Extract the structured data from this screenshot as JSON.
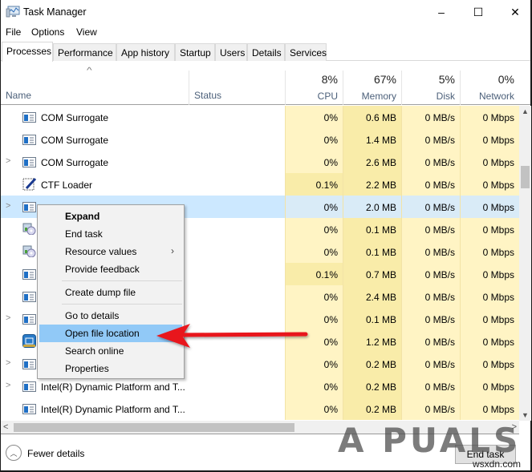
{
  "window": {
    "title": "Task Manager",
    "controls": {
      "minimize": "–",
      "maximize": "☐",
      "close": "✕"
    }
  },
  "menu": [
    "File",
    "Options",
    "View"
  ],
  "tabs": [
    {
      "label": "Processes",
      "active": true
    },
    {
      "label": "Performance",
      "active": false
    },
    {
      "label": "App history",
      "active": false
    },
    {
      "label": "Startup",
      "active": false
    },
    {
      "label": "Users",
      "active": false
    },
    {
      "label": "Details",
      "active": false
    },
    {
      "label": "Services",
      "active": false
    }
  ],
  "columns": {
    "name": "Name",
    "status": "Status",
    "cpu": {
      "percent": "8%",
      "label": "CPU"
    },
    "memory": {
      "percent": "67%",
      "label": "Memory"
    },
    "disk": {
      "percent": "5%",
      "label": "Disk"
    },
    "network": {
      "percent": "0%",
      "label": "Network"
    }
  },
  "rows": [
    {
      "name": "COM Surrogate",
      "icon": "app-window-icon",
      "expander": false,
      "cpu": "0%",
      "memory": "0.6 MB",
      "disk": "0 MB/s",
      "network": "0 Mbps"
    },
    {
      "name": "COM Surrogate",
      "icon": "app-window-icon",
      "expander": false,
      "cpu": "0%",
      "memory": "1.4 MB",
      "disk": "0 MB/s",
      "network": "0 Mbps"
    },
    {
      "name": "COM Surrogate",
      "icon": "app-window-icon",
      "expander": true,
      "cpu": "0%",
      "memory": "2.6 MB",
      "disk": "0 MB/s",
      "network": "0 Mbps"
    },
    {
      "name": "CTF Loader",
      "icon": "ctf-loader-icon",
      "expander": false,
      "cpu": "0.1%",
      "memory": "2.2 MB",
      "disk": "0 MB/s",
      "network": "0 Mbps"
    },
    {
      "name": "",
      "icon": "app-window-icon",
      "expander": true,
      "selected": true,
      "cpu": "0%",
      "memory": "2.0 MB",
      "disk": "0 MB/s",
      "network": "0 Mbps"
    },
    {
      "name": "",
      "icon": "installer-disc-icon",
      "expander": false,
      "cpu": "0%",
      "memory": "0.1 MB",
      "disk": "0 MB/s",
      "network": "0 Mbps"
    },
    {
      "name": "",
      "icon": "installer-disc-icon",
      "expander": false,
      "cpu": "0%",
      "memory": "0.1 MB",
      "disk": "0 MB/s",
      "network": "0 Mbps"
    },
    {
      "name": "",
      "icon": "app-window-icon",
      "expander": false,
      "cpu": "0.1%",
      "memory": "0.7 MB",
      "disk": "0 MB/s",
      "network": "0 Mbps"
    },
    {
      "name": "",
      "icon": "app-window-icon",
      "expander": false,
      "cpu": "0%",
      "memory": "2.4 MB",
      "disk": "0 MB/s",
      "network": "0 Mbps"
    },
    {
      "name": "",
      "icon": "app-window-icon",
      "expander": true,
      "cpu": "0%",
      "memory": "0.1 MB",
      "disk": "0 MB/s",
      "network": "0 Mbps"
    },
    {
      "name": "",
      "icon": "intel-graphics-icon",
      "expander": false,
      "cpu": "0%",
      "memory": "1.2 MB",
      "disk": "0 MB/s",
      "network": "0 Mbps"
    },
    {
      "name": "",
      "icon": "app-window-icon",
      "expander": true,
      "cpu": "0%",
      "memory": "0.2 MB",
      "disk": "0 MB/s",
      "network": "0 Mbps"
    },
    {
      "name": "Intel(R) Dynamic Platform and T...",
      "icon": "app-window-icon",
      "expander": true,
      "cpu": "0%",
      "memory": "0.2 MB",
      "disk": "0 MB/s",
      "network": "0 Mbps"
    },
    {
      "name": "Intel(R) Dynamic Platform and T...",
      "icon": "app-window-icon",
      "expander": false,
      "cpu": "0%",
      "memory": "0.2 MB",
      "disk": "0 MB/s",
      "network": "0 Mbps"
    }
  ],
  "context_menu": {
    "groups": [
      [
        {
          "label": "Expand",
          "bold": true
        },
        {
          "label": "End task"
        },
        {
          "label": "Resource values",
          "submenu": true
        },
        {
          "label": "Provide feedback"
        }
      ],
      [
        {
          "label": "Create dump file"
        }
      ],
      [
        {
          "label": "Go to details"
        },
        {
          "label": "Open file location",
          "highlighted": true
        },
        {
          "label": "Search online"
        },
        {
          "label": "Properties"
        }
      ]
    ]
  },
  "footer": {
    "fewer_details": "Fewer details",
    "end_task": "End task"
  },
  "watermark": {
    "text": "A PUALS",
    "site": "wsxdn.com"
  },
  "colors": {
    "selected_row": "#cce8ff",
    "heat_light": "#fff4c4",
    "heat_medium": "#f9eca9",
    "menu_highlight": "#91c9f7",
    "annotation_arrow": "#e8131b"
  }
}
